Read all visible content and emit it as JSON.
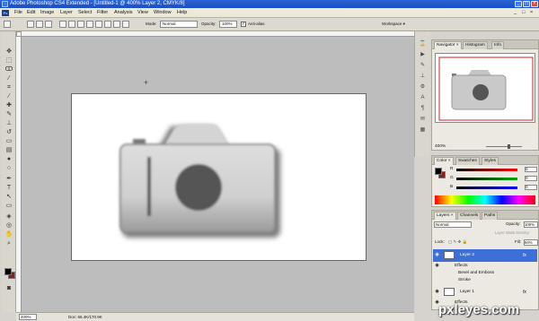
{
  "window": {
    "title": "Adobe Photoshop CS4 Extended - [Untitled-1 @ 400% Layer 2, CMYK/8]",
    "buttons": {
      "minimize": "_",
      "restore": "□",
      "close": "×"
    }
  },
  "menu": {
    "items": [
      "File",
      "Edit",
      "Image",
      "Layer",
      "Select",
      "Filter",
      "Analysis",
      "View",
      "Window",
      "Help"
    ],
    "doc_controls": {
      "minimize": "_",
      "restore": "□",
      "close": "×"
    }
  },
  "options": {
    "mode_label": "Mode:",
    "mode_value": "Normal",
    "opacity_label": "Opacity:",
    "opacity_value": "100%",
    "antialias_label": "Anti-alias",
    "workspace_label": "Workspace ▾"
  },
  "status": {
    "zoom": "400%",
    "doc_size": "Doc: 66.4K/170.9K"
  },
  "navigator": {
    "tabs": [
      "Navigator",
      "Histogram",
      "Info"
    ],
    "zoom": "400%"
  },
  "color": {
    "tabs": [
      "Color",
      "Swatches",
      "Styles"
    ],
    "channels": [
      {
        "label": "R",
        "value": "0"
      },
      {
        "label": "G",
        "value": "0"
      },
      {
        "label": "B",
        "value": "0"
      }
    ]
  },
  "layers": {
    "tabs": [
      "Layers",
      "Channels",
      "Paths"
    ],
    "blend_mode": "Normal",
    "opacity_label": "Opacity:",
    "opacity_value": "100%",
    "fill_label": "Fill:",
    "fill_value": "94%",
    "lock_label": "Lock:",
    "mask_label": "Layer Mask Density:",
    "rows": [
      {
        "name": "Layer 2",
        "fx": "fx",
        "selected": true
      },
      {
        "name": "Effects"
      },
      {
        "name": "Bevel and Emboss"
      },
      {
        "name": "Stroke"
      },
      {
        "name": "Layer 1",
        "fx": "fx"
      },
      {
        "name": "Effects"
      }
    ]
  },
  "watermark": "pxleyes.com",
  "colors": {
    "titlebar": "#2b63d8",
    "foreground": "#000000",
    "background": "#8b1d1d",
    "selected_layer": "#3d6fd8"
  }
}
